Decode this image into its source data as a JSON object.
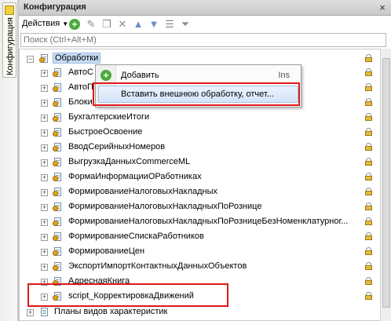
{
  "side_panel": {
    "tab_label": "Конфигурация"
  },
  "window": {
    "title": "Конфигурация",
    "close_glyph": "×"
  },
  "toolbar": {
    "actions_label": "Действия",
    "actions_caret": "▼",
    "icons": [
      "add-icon",
      "edit-icon",
      "copy-icon",
      "delete-icon",
      "move-up-icon",
      "move-down-icon",
      "list-icon",
      "filter-icon"
    ]
  },
  "search": {
    "placeholder": "Поиск (Ctrl+Alt+M)"
  },
  "tree": {
    "root": {
      "label": "Обработки",
      "expander": "⊖"
    },
    "items": [
      {
        "label": "АвтоС"
      },
      {
        "label": "АвтоП"
      },
      {
        "label": "Блоки"
      },
      {
        "label": "БухгалтерскиеИтоги"
      },
      {
        "label": "БыстроеОсвоение"
      },
      {
        "label": "ВводСерийныхНомеров"
      },
      {
        "label": "ВыгрузкаДанныхCommerceML"
      },
      {
        "label": "ФормаИнформацииОРаботниках"
      },
      {
        "label": "ФормированиеНалоговыхНакладных"
      },
      {
        "label": "ФормированиеНалоговыхНакладныхПоРознице"
      },
      {
        "label": "ФормированиеНалоговыхНакладныхПоРозницеБезНоменклатурног..."
      },
      {
        "label": "ФормированиеСпискаРаботников"
      },
      {
        "label": "ФормированиеЦен"
      },
      {
        "label": "ЭкспортИмпортКонтактныхДанныхОбъектов"
      },
      {
        "label": "АдреснаяКнига"
      },
      {
        "label": "script_КорректировкаДвижений"
      }
    ],
    "next_group": {
      "label": "Планы видов характеристик"
    }
  },
  "context_menu": {
    "add_label": "Добавить",
    "add_shortcut": "Ins",
    "insert_external_label": "Вставить внешнюю обработку, отчет..."
  },
  "colors": {
    "highlight_frame": "#e01818",
    "selection": "#c8dcf5",
    "add_green": "#4bab3a"
  }
}
